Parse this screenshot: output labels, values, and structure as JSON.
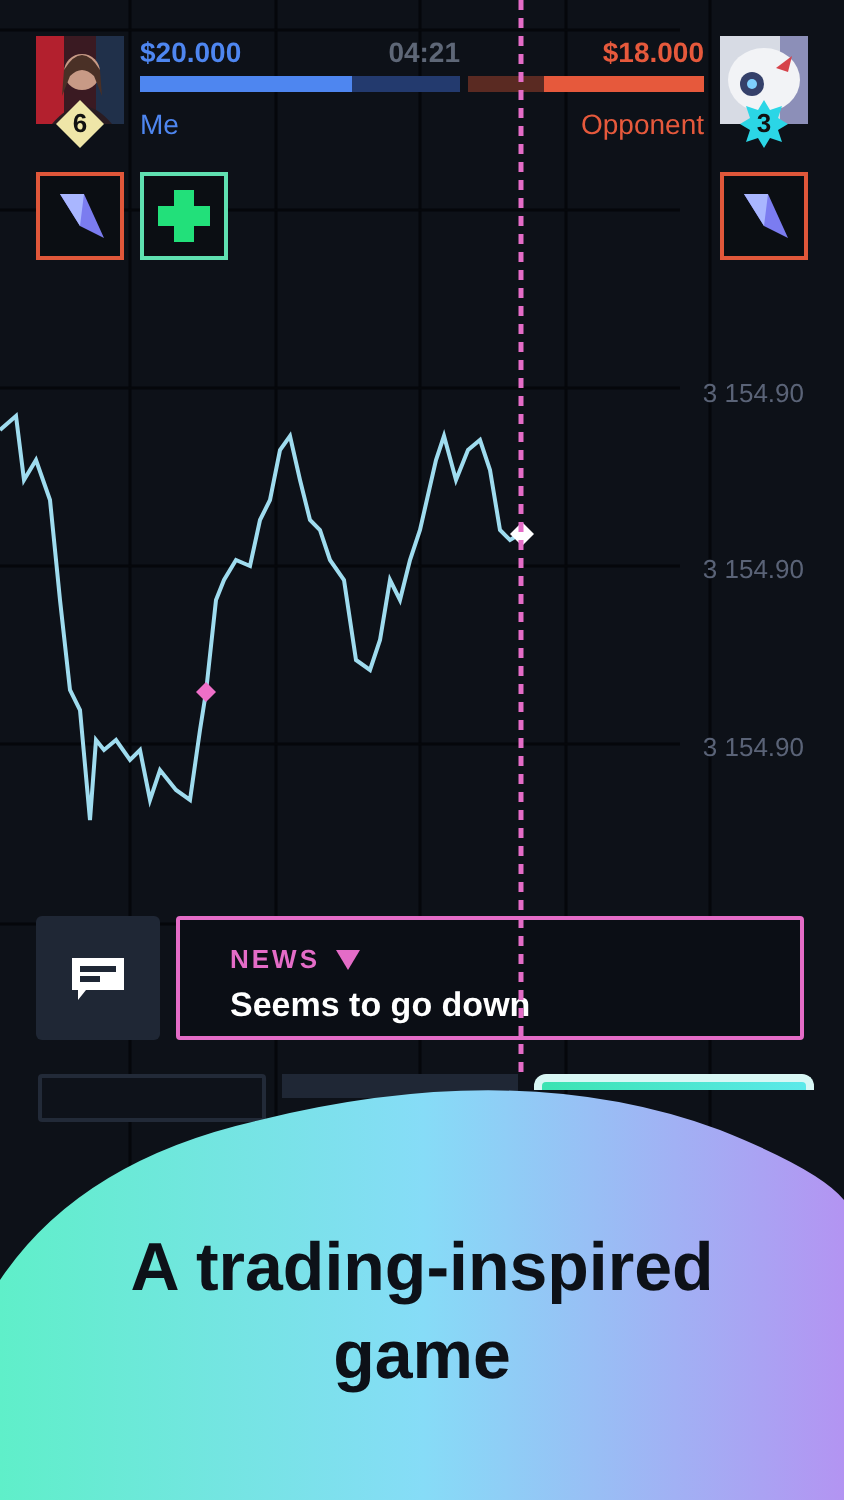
{
  "player": {
    "name": "Me",
    "money": "$20.000",
    "badge": "6",
    "level": 0.66
  },
  "timer": "04:21",
  "opponent": {
    "name": "Opponent",
    "money": "$18.000",
    "badge": "3",
    "level": 0.68
  },
  "player_powerups": [
    {
      "kind": "lightning"
    },
    {
      "kind": "health"
    }
  ],
  "opponent_powerups": [
    {
      "kind": "lightning"
    }
  ],
  "price_labels": [
    "3 154.90",
    "3 154.90",
    "3 154.90"
  ],
  "news": {
    "label": "NEWS",
    "message": "Seems to go down"
  },
  "caption": "A trading-inspired game"
}
